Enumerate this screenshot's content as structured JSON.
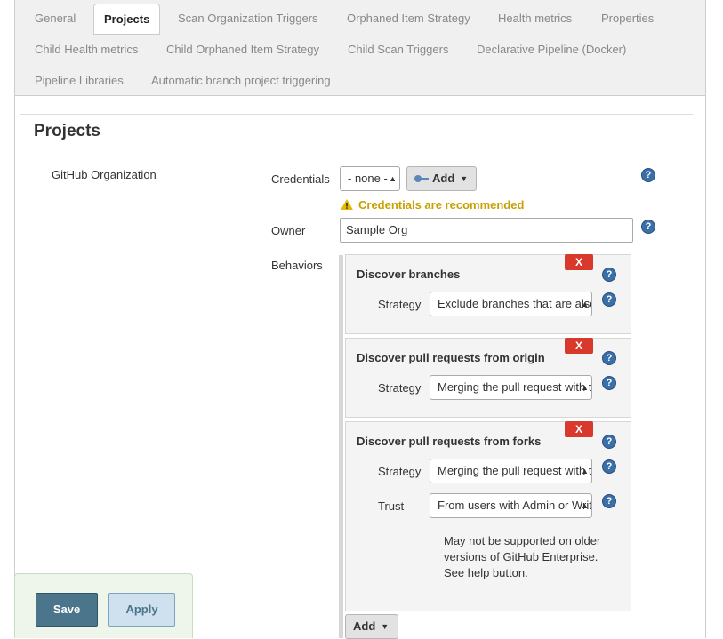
{
  "tabs": [
    {
      "label": "General",
      "active": false
    },
    {
      "label": "Projects",
      "active": true
    },
    {
      "label": "Scan Organization Triggers",
      "active": false
    },
    {
      "label": "Orphaned Item Strategy",
      "active": false
    },
    {
      "label": "Health metrics",
      "active": false
    },
    {
      "label": "Properties",
      "active": false
    },
    {
      "label": "Child Health metrics",
      "active": false
    },
    {
      "label": "Child Orphaned Item Strategy",
      "active": false
    },
    {
      "label": "Child Scan Triggers",
      "active": false
    },
    {
      "label": "Declarative Pipeline (Docker)",
      "active": false
    },
    {
      "label": "Pipeline Libraries",
      "active": false
    },
    {
      "label": "Automatic branch project triggering",
      "active": false
    }
  ],
  "section": {
    "title": "Projects"
  },
  "source": {
    "label": "GitHub Organization"
  },
  "credentials": {
    "label": "Credentials",
    "selected": "- none -",
    "add_label": "Add",
    "warning": "Credentials are recommended"
  },
  "owner": {
    "label": "Owner",
    "value": "Sample Org"
  },
  "behaviors": {
    "label": "Behaviors",
    "remove_label": "X",
    "items": [
      {
        "title": "Discover branches",
        "strategy_label": "Strategy",
        "strategy_value": "Exclude branches that are also filed as PRs"
      },
      {
        "title": "Discover pull requests from origin",
        "strategy_label": "Strategy",
        "strategy_value": "Merging the pull request with the current target branch revision"
      },
      {
        "title": "Discover pull requests from forks",
        "strategy_label": "Strategy",
        "strategy_value": "Merging the pull request with the current target branch revision",
        "trust_label": "Trust",
        "trust_value": "From users with Admin or Write permission",
        "note": "May not be supported on older versions of GitHub Enterprise. See help button."
      }
    ],
    "add_label": "Add"
  },
  "footer": {
    "save_label": "Save",
    "apply_label": "Apply"
  },
  "help_glyph": "?",
  "colors": {
    "remove": "#d9382c",
    "save": "#4b758b",
    "apply": "#cfe0ee",
    "warning": "#c8a000",
    "help": "#3a6fa8"
  }
}
